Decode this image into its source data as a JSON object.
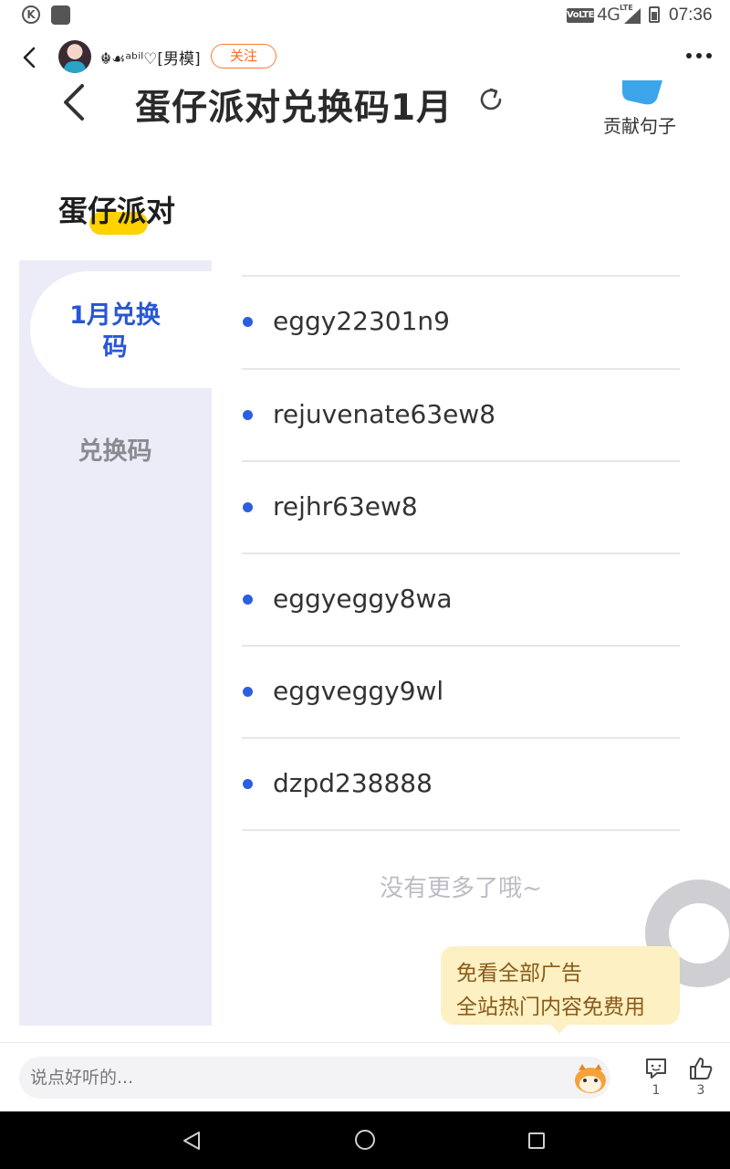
{
  "status_bar": {
    "k_badge": "K",
    "volte": "VoLTE",
    "network": "4G",
    "lte": "LTE",
    "time": "07:36"
  },
  "post_header": {
    "username": "☬☙ᵃᵇⁱˡ♡[男模]",
    "follow_label": "关注"
  },
  "screenshot": {
    "title": "蛋仔派对兑换码1月",
    "contribute_label": "贡献句子",
    "brand_title": "蛋仔派对",
    "side_tabs": [
      {
        "label": "1月兑换\n码",
        "active": true
      },
      {
        "label": "兑换码",
        "active": false
      }
    ],
    "codes": [
      "eggy22301n9",
      "rejuvenate63ew8",
      "rejhr63ew8",
      "eggyeggy8wa",
      "eggveggy9wl",
      "dzpd238888"
    ],
    "no_more": "没有更多了哦~",
    "ad_line1": "免看全部广告",
    "ad_line2": "全站热门内容免费用"
  },
  "comment_bar": {
    "placeholder": "说点好听的...",
    "reply_count": "1",
    "like_count": "3"
  },
  "colors": {
    "accent_blue": "#2956d6",
    "follow_orange": "#ff6a1f",
    "brand_yellow": "#ffd200"
  }
}
